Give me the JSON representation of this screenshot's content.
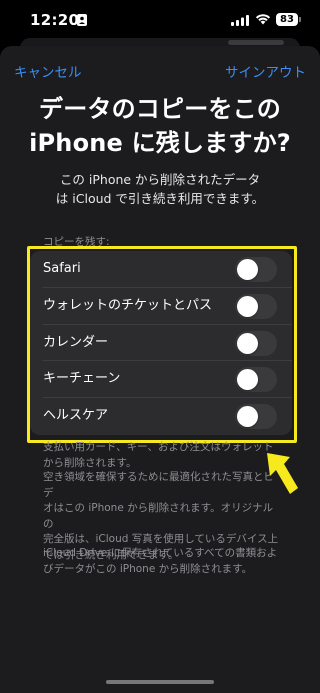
{
  "status_bar": {
    "time": "12:20",
    "battery": "83",
    "icons": [
      "person-badge-icon",
      "cellular-signal-icon",
      "wifi-icon",
      "battery-icon"
    ]
  },
  "nav": {
    "cancel_label": "キャンセル",
    "signout_label": "サインアウト"
  },
  "title_line1": "データのコピーをこの",
  "title_line2": "iPhone に残しますか?",
  "subtitle_line1": "この iPhone から削除されたデータ",
  "subtitle_line2": "は iCloud で引き続き利用できます。",
  "section_header": "コピーを残す:",
  "items": [
    {
      "label": "Safari",
      "on": false
    },
    {
      "label": "ウォレットのチケットとパス",
      "on": false
    },
    {
      "label": "カレンダー",
      "on": false
    },
    {
      "label": "キーチェーン",
      "on": false
    },
    {
      "label": "ヘルスケア",
      "on": false
    }
  ],
  "footnotes": {
    "fn1_line1": "支払い用カード、キー、および注文はウォレット",
    "fn1_line2": "から削除されます。",
    "fn2_line1": "空き領域を確保するために最適化された写真とビデ",
    "fn2_line2": "オはこの iPhone から削除されます。オリジナルの",
    "fn2_line3": "完全版は、iCloud 写真を使用しているデバイス上",
    "fn2_line4": "では引き続き利用できます。",
    "fn3_line1": "iCloud Drive に保存されているすべての書類およ",
    "fn3_line2": "びデータがこの iPhone から削除されます。"
  },
  "colors": {
    "accent": "#3a8ff6",
    "highlight": "#f6e91d",
    "sheet_bg": "#1c1c1e",
    "group_bg": "#2c2c2e"
  }
}
